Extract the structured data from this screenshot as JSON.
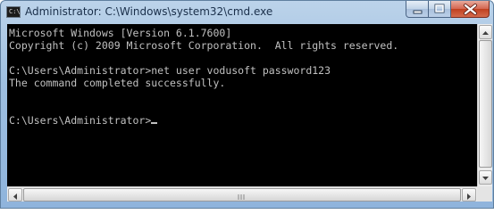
{
  "window": {
    "title": "Administrator: C:\\Windows\\system32\\cmd.exe",
    "icon": "cmd-icon",
    "icon_text": "C:\\"
  },
  "controls": {
    "minimize_icon": "minimize-icon",
    "maximize_icon": "maximize-icon",
    "close_icon": "close-icon"
  },
  "console": {
    "lines": [
      "Microsoft Windows [Version 6.1.7600]",
      "Copyright (c) 2009 Microsoft Corporation.  All rights reserved.",
      "",
      "C:\\Users\\Administrator>net user vodusoft password123",
      "The command completed successfully.",
      "",
      "",
      "C:\\Users\\Administrator>"
    ]
  },
  "colors": {
    "console_bg": "#000000",
    "console_fg": "#c0c0c0",
    "titlebar": "#9ebfe0",
    "close_button": "#c0401f"
  }
}
